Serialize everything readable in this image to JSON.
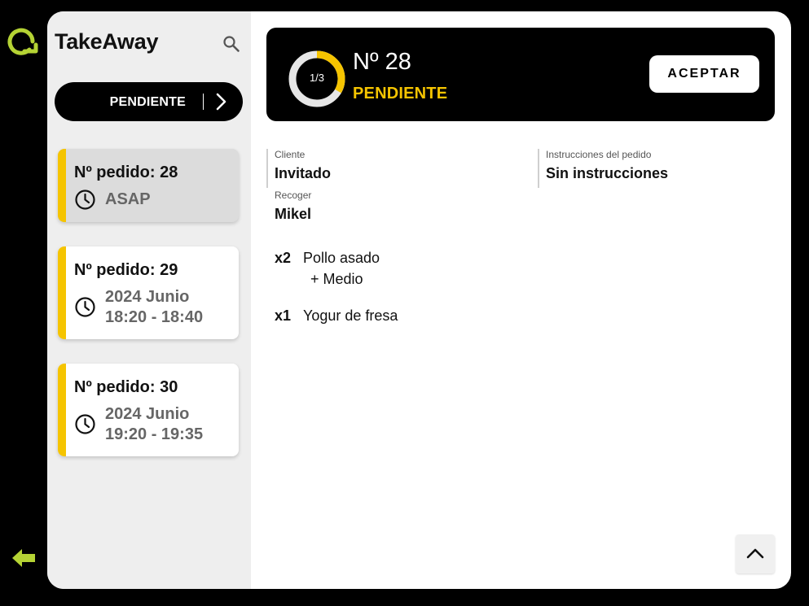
{
  "app": {
    "title": "TakeAway"
  },
  "filter": {
    "status_label": "PENDIENTE"
  },
  "orders": [
    {
      "label": "Nº pedido: 28",
      "time_line1": "ASAP",
      "time_line2": "",
      "active": true
    },
    {
      "label": "Nº pedido: 29",
      "time_line1": "2024 Junio",
      "time_line2": "18:20 - 18:40",
      "active": false
    },
    {
      "label": "Nº pedido: 30",
      "time_line1": "2024 Junio",
      "time_line2": "19:20 - 19:35",
      "active": false
    }
  ],
  "header": {
    "progress_text": "1/3",
    "progress_current": 1,
    "progress_total": 3,
    "order_number": "Nº 28",
    "status": "PENDIENTE",
    "accept_label": "ACEPTAR"
  },
  "details": {
    "cliente_label": "Cliente",
    "cliente_value": "Invitado",
    "instr_label": "Instrucciones del pedido",
    "instr_value": "Sin instrucciones",
    "recoger_label": "Recoger",
    "recoger_value": "Mikel"
  },
  "items": [
    {
      "qty": "x2",
      "name": "Pollo asado",
      "modifier": "+ Medio"
    },
    {
      "qty": "x1",
      "name": "Yogur de fresa",
      "modifier": ""
    }
  ],
  "colors": {
    "accent": "#f5c400",
    "logo": "#b5d334",
    "banner": "#000000",
    "sidebar": "#eeeeee"
  },
  "icons": {
    "logo": "rotate-logo-icon",
    "back": "arrow-left-icon",
    "search": "search-icon",
    "chevron": "chevron-right-icon",
    "clock": "clock-icon",
    "scroll": "chevron-up-icon"
  }
}
